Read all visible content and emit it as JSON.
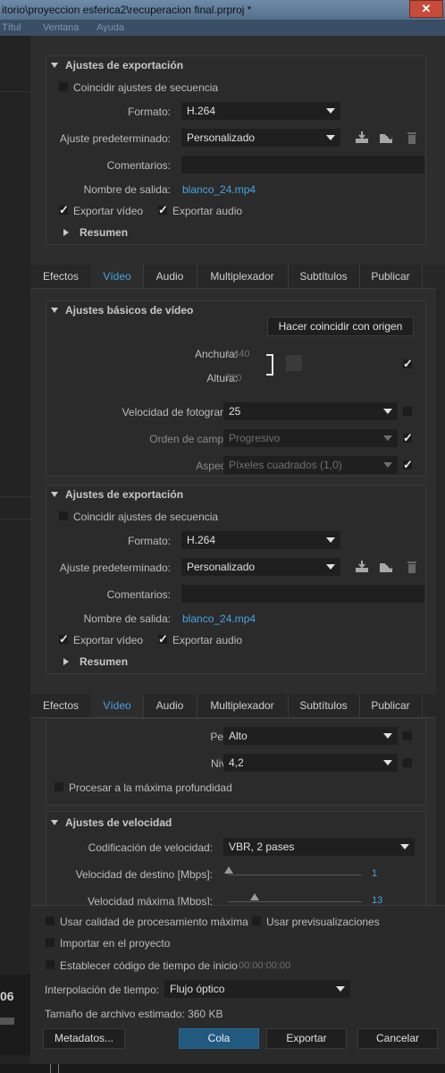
{
  "window": {
    "title": "itorio\\proyeccion esferica2\\recuperacion final.prproj *",
    "close": "✕"
  },
  "menu": [
    "Títul",
    "Ventana",
    "Ayuda"
  ],
  "export_settings": {
    "heading": "Ajustes de exportación",
    "match_sequence": "Coincidir ajustes de secuencia",
    "format_label": "Formato:",
    "format_value": "H.264",
    "preset_label": "Ajuste predeterminado:",
    "preset_value": "Personalizado",
    "comments_label": "Comentarios:",
    "output_label": "Nombre de salida:",
    "output_value": "blanco_24.mp4",
    "export_video": "Exportar vídeo",
    "export_audio": "Exportar audio",
    "summary": "Resumen"
  },
  "tabs": [
    "Efectos",
    "Vídeo",
    "Audio",
    "Multiplexador",
    "Subtítulos",
    "Publicar"
  ],
  "basic_video": {
    "heading": "Ajustes básicos de vídeo",
    "match_source": "Hacer coincidir con origen",
    "width_label": "Anchura:",
    "width_value": "1.440",
    "height_label": "Altura:",
    "height_value": "720",
    "framerate_label": "Velocidad de fotograma:",
    "framerate_value": "25",
    "field_order_label": "Orden de campos:",
    "field_order_value": "Progresivo",
    "aspect_label": "Aspecto:",
    "aspect_value": "Píxeles cuadrados (1,0)"
  },
  "encoding": {
    "profile_label": "Perfil:",
    "profile_value": "Alto",
    "level_label": "Nivel:",
    "level_value": "4,2",
    "max_depth": "Procesar a la máxima profundidad"
  },
  "bitrate": {
    "heading": "Ajustes de velocidad",
    "encoding_label": "Codificación de velocidad:",
    "encoding_value": "VBR, 2 pases",
    "target_label": "Velocidad de destino [Mbps]:",
    "target_value": "1",
    "max_label": "Velocidad máxima [Mbps]:",
    "max_value": "13"
  },
  "footer": {
    "max_quality": "Usar calidad de procesamiento máxima",
    "use_previews": "Usar previsualizaciones",
    "import_project": "Importar en el proyecto",
    "set_timecode": "Establecer código de tiempo de inicio",
    "timecode": "00:00:00:00",
    "interp_label": "Interpolación de tiempo:",
    "interp_value": "Flujo óptico",
    "filesize": "Tamaño de archivo estimado:  360 KB",
    "metadata_btn": "Metadatos...",
    "queue_btn": "Cola",
    "export_btn": "Exportar",
    "cancel_btn": "Cancelar"
  },
  "left_number": "06"
}
